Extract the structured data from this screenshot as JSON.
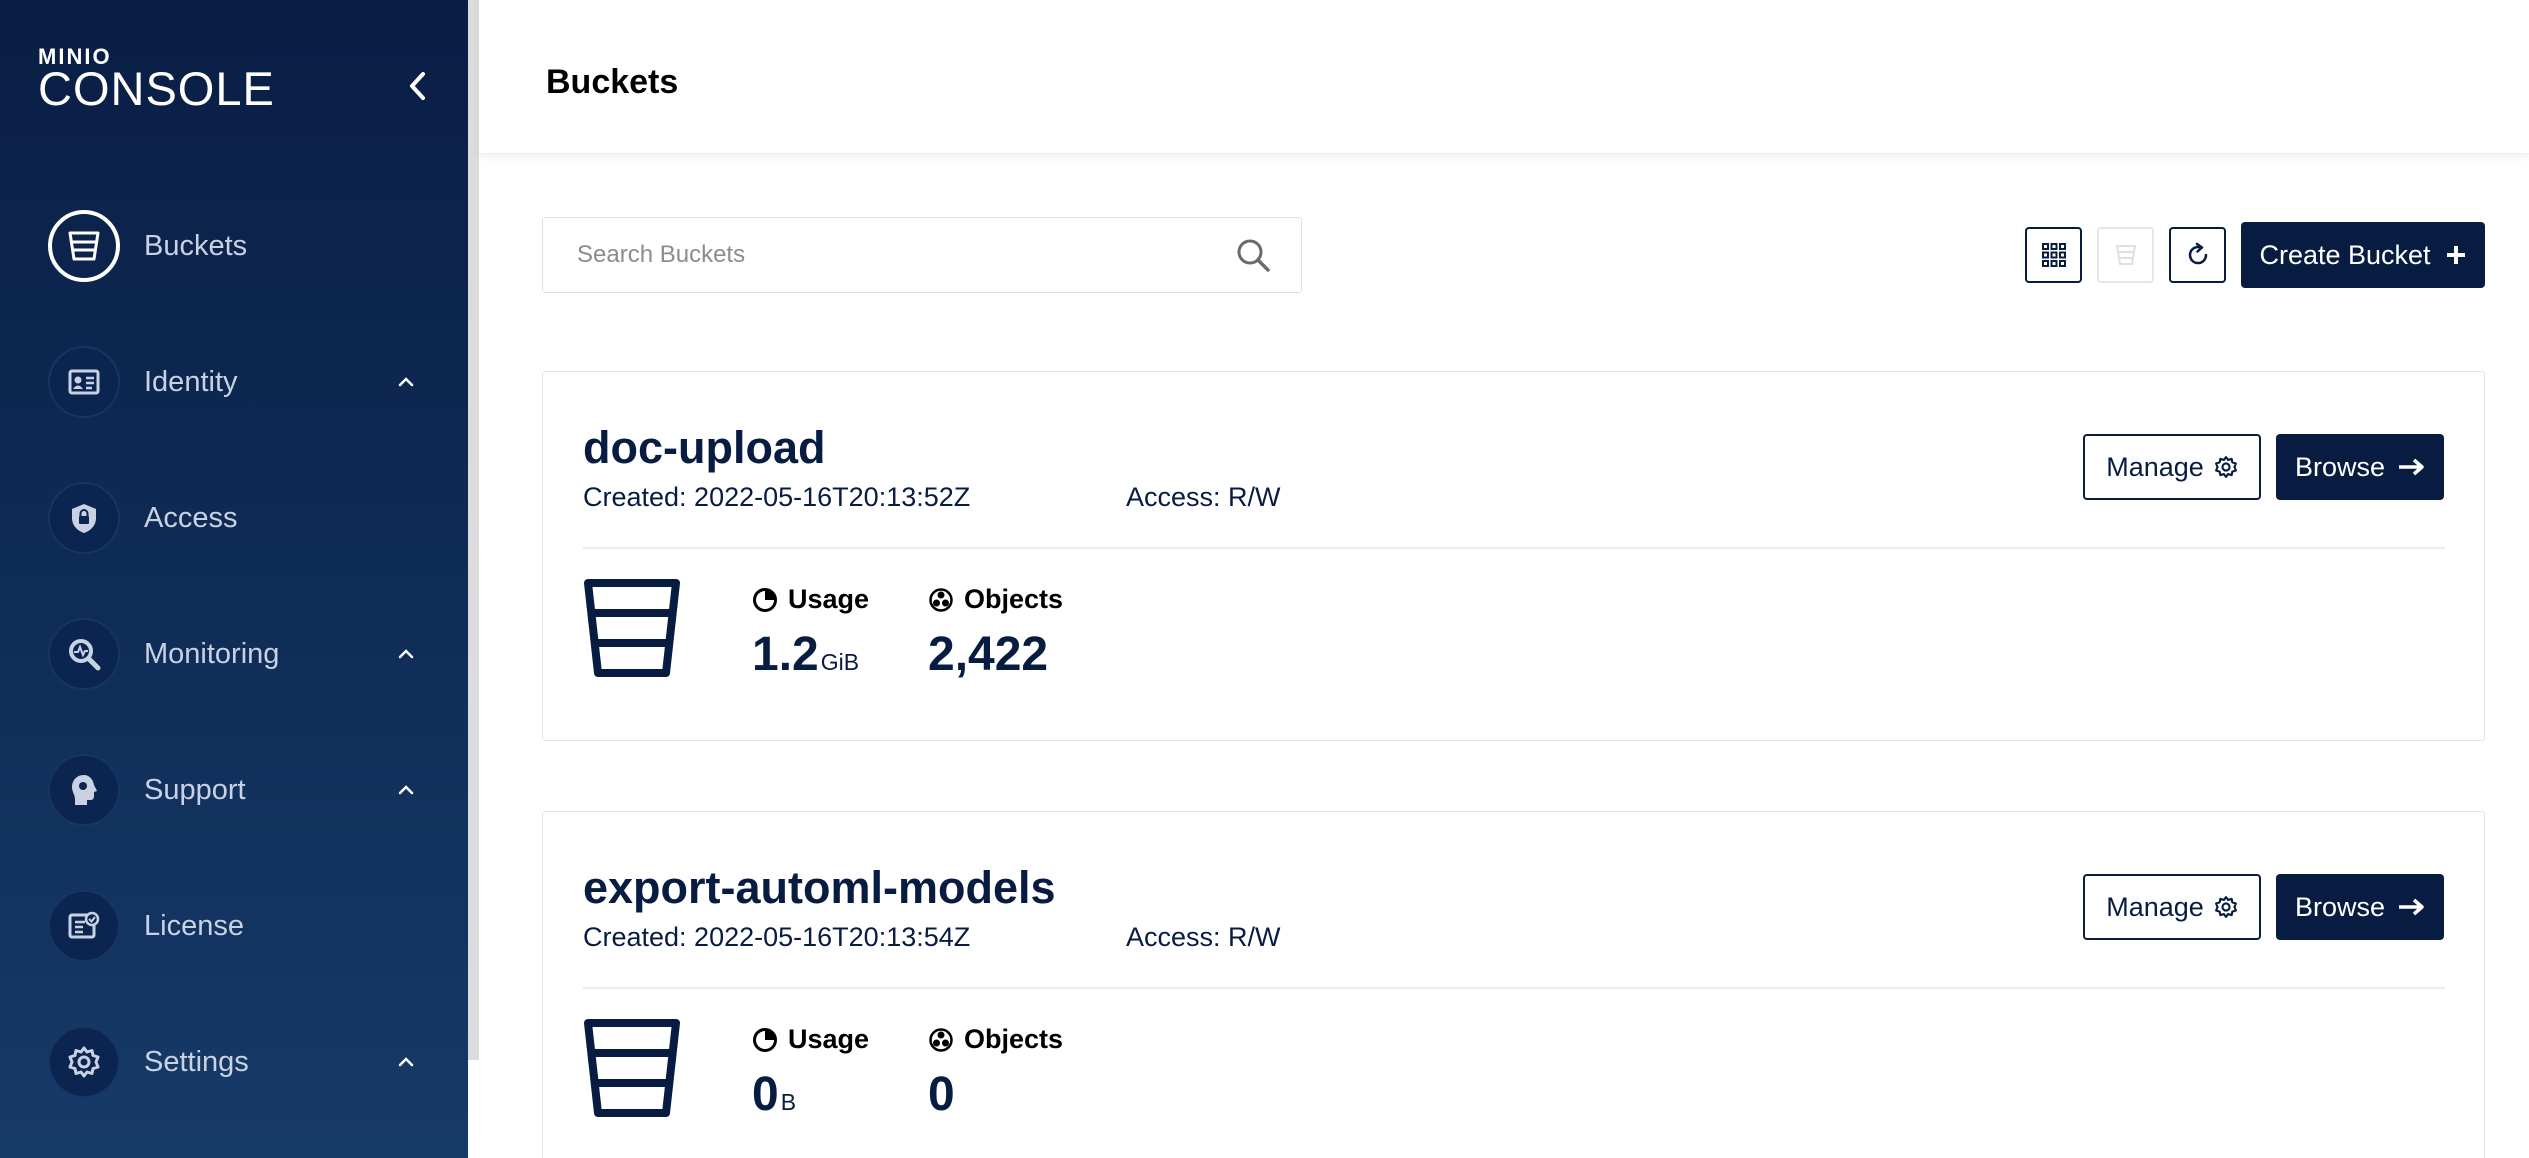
{
  "sidebar": {
    "logo_brand": "MINIO",
    "logo_product": "CONSOLE",
    "items": [
      {
        "label": "Buckets",
        "icon": "bucket-icon",
        "active": true
      },
      {
        "label": "Identity",
        "icon": "id-card-icon",
        "expandable": true
      },
      {
        "label": "Access",
        "icon": "lock-shield-icon"
      },
      {
        "label": "Monitoring",
        "icon": "magnifier-chart-icon",
        "expandable": true
      },
      {
        "label": "Support",
        "icon": "headset-icon",
        "expandable": true
      },
      {
        "label": "License",
        "icon": "license-certificate-icon"
      },
      {
        "label": "Settings",
        "icon": "gear-icon",
        "expandable": true
      }
    ]
  },
  "header": {
    "title": "Buckets"
  },
  "toolbar": {
    "search_placeholder": "Search Buckets",
    "create_label": "Create Bucket"
  },
  "buckets": [
    {
      "name": "doc-upload",
      "created": "Created: 2022-05-16T20:13:52Z",
      "access": "Access: R/W",
      "usage_label": "Usage",
      "usage_value": "1.2",
      "usage_unit": "GiB",
      "objects_label": "Objects",
      "objects_value": "2,422",
      "manage_label": "Manage",
      "browse_label": "Browse"
    },
    {
      "name": "export-automl-models",
      "created": "Created: 2022-05-16T20:13:54Z",
      "access": "Access: R/W",
      "usage_label": "Usage",
      "usage_value": "0",
      "usage_unit": "B",
      "objects_label": "Objects",
      "objects_value": "0",
      "manage_label": "Manage",
      "browse_label": "Browse"
    }
  ],
  "colors": {
    "navy": "#081c42",
    "sidebar_top": "#0a1e45",
    "sidebar_bottom": "#163a68",
    "muted_text": "#c8d2e2"
  }
}
